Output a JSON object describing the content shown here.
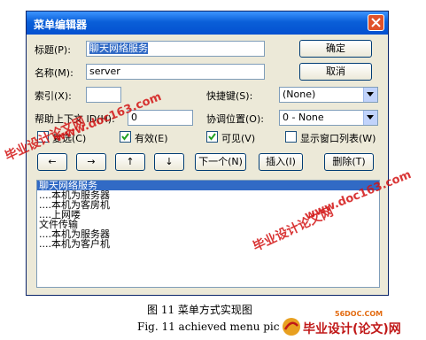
{
  "window": {
    "title": "菜单编辑器",
    "fields": {
      "caption_label": "标题(P):",
      "caption_value": "聊天网络服务",
      "name_label": "名称(M):",
      "name_value": "server",
      "index_label": "索引(X):",
      "index_value": "",
      "shortcut_label": "快捷键(S):",
      "shortcut_value": "(None)",
      "helpctx_label": "帮助上下文 ID(H):",
      "helpctx_value": "0",
      "negotiate_label": "协调位置(O):",
      "negotiate_value": "0 - None"
    },
    "checks": {
      "checked_label": "复选(C)",
      "checked_on": false,
      "enabled_label": "有效(E)",
      "enabled_on": true,
      "visible_label": "可见(V)",
      "visible_on": true,
      "windowlist_label": "显示窗口列表(W)",
      "windowlist_on": false
    },
    "buttons": {
      "ok": "确定",
      "cancel": "取消",
      "next": "下一个(N)",
      "insert": "插入(I)",
      "delete": "删除(T)",
      "arrow_left": "←",
      "arrow_right": "→",
      "arrow_up": "↑",
      "arrow_down": "↓"
    },
    "list_items": [
      "聊天网络服务",
      "....本机为服务器",
      "....本机为客房机",
      "....上网喽",
      "文件传输",
      "....本机为服务器",
      "....本机为客户机"
    ],
    "selected_index": 0
  },
  "watermarks": {
    "text_a": "毕业设计论文网",
    "text_b": "www.doc163.com"
  },
  "caption": {
    "cn": "图 11    菜单方式实现图",
    "en": "Fig. 11    achieved menu pic"
  },
  "logo": {
    "site": "56DOC.COM",
    "name": "毕业设计(论文)网"
  },
  "colors": {
    "accent": "#0a5fd8",
    "watermark": "#d31414",
    "selection": "#316ac5"
  }
}
